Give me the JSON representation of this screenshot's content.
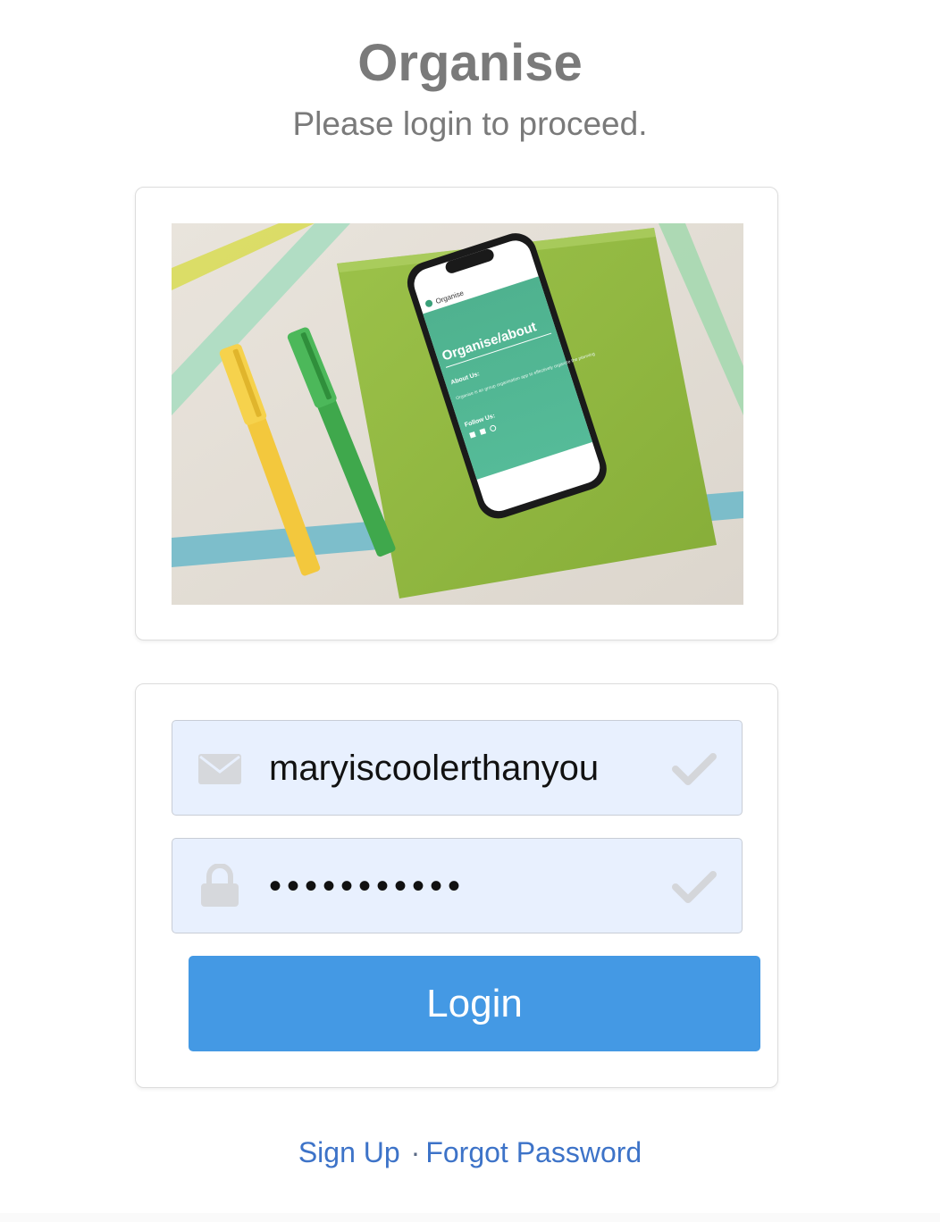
{
  "header": {
    "title": "Organise",
    "subtitle": "Please login to proceed."
  },
  "hero_image": {
    "phone_screen": {
      "brand": "Organise",
      "heading": "Organise/about",
      "about_label": "About Us:",
      "body_text": "Organise is an group organisation app to effectively organize the planning",
      "follow_label": "Follow Us:"
    }
  },
  "form": {
    "email": {
      "value": "maryiscoolerthanyou",
      "icon": "envelope-icon",
      "status_icon": "check-icon"
    },
    "password": {
      "value": "•••••••••••",
      "icon": "lock-icon",
      "status_icon": "check-icon"
    },
    "login_label": "Login"
  },
  "footer_links": {
    "signup": "Sign Up",
    "separator": "·",
    "forgot": "Forgot Password"
  },
  "colors": {
    "primary": "#4499e4",
    "link": "#3d73c8",
    "heading": "#7a7a7a",
    "autofill_bg": "#e8f0fe"
  }
}
